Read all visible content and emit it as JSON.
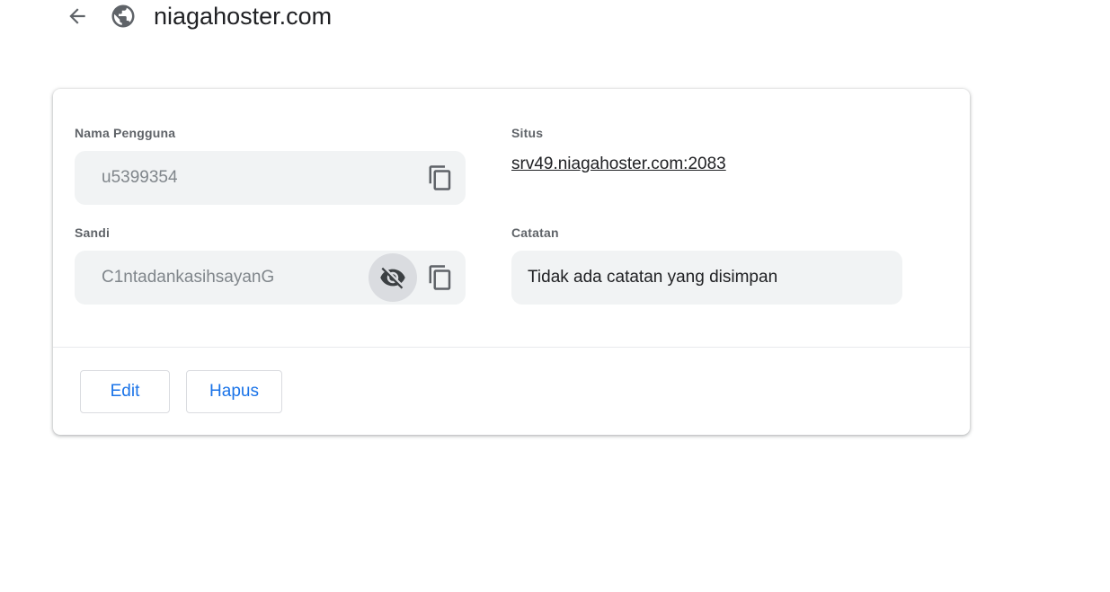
{
  "header": {
    "title": "niagahoster.com",
    "back_icon": "arrow-back-icon",
    "site_icon": "globe-icon"
  },
  "card": {
    "username": {
      "label": "Nama Pengguna",
      "value": "u5399354",
      "copy_icon": "copy-icon"
    },
    "site": {
      "label": "Situs",
      "value": "srv49.niagahoster.com:2083"
    },
    "password": {
      "label": "Sandi",
      "value": "C1ntadankasihsayanG",
      "visibility_icon": "visibility-off-icon",
      "copy_icon": "copy-icon"
    },
    "notes": {
      "label": "Catatan",
      "value": "Tidak ada catatan yang disimpan"
    },
    "actions": {
      "edit_label": "Edit",
      "delete_label": "Hapus"
    }
  },
  "colors": {
    "accent": "#1a73e8",
    "field_background": "#f1f3f4",
    "label_text": "#5f6368",
    "icon": "#5f6368"
  }
}
